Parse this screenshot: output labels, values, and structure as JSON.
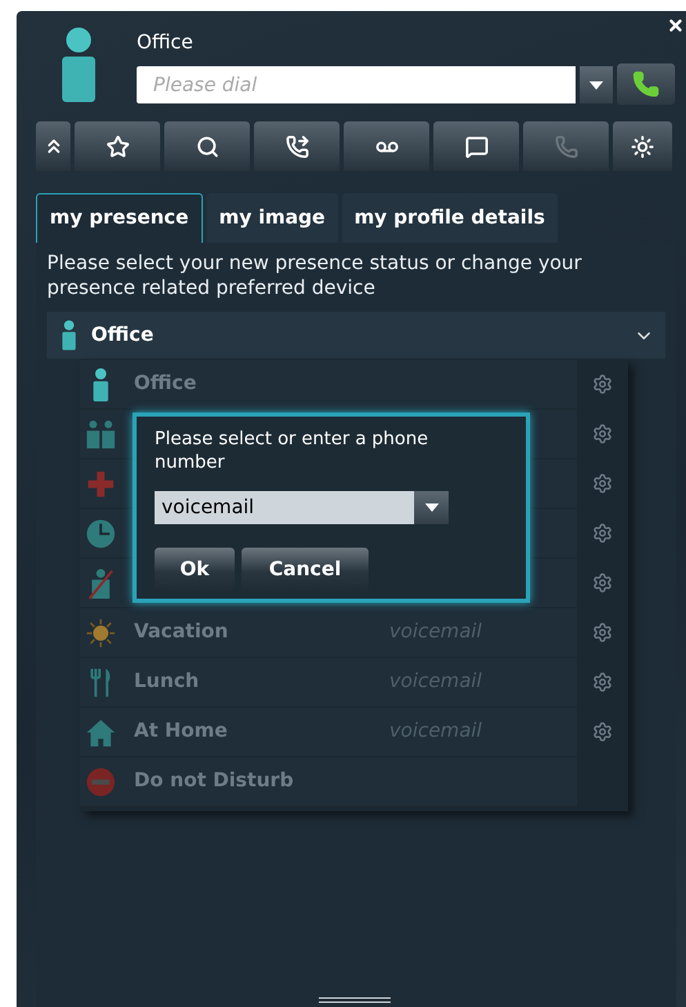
{
  "header": {
    "presence_label": "Office",
    "dial_field": {
      "placeholder": "Please dial"
    }
  },
  "toolbar": [
    {
      "kind": "collapse",
      "disabled": false
    },
    {
      "kind": "favorites",
      "disabled": false
    },
    {
      "kind": "search",
      "disabled": false
    },
    {
      "kind": "forward",
      "disabled": false
    },
    {
      "kind": "voicemail",
      "disabled": false
    },
    {
      "kind": "chat",
      "disabled": false
    },
    {
      "kind": "phone",
      "disabled": true
    },
    {
      "kind": "settings",
      "disabled": false
    }
  ],
  "tabs": [
    {
      "label": "my presence",
      "selected": true
    },
    {
      "label": "my image",
      "selected": false
    },
    {
      "label": "my profile details",
      "selected": false
    }
  ],
  "description": "Please select your new presence status or change your presence related preferred device",
  "presence_select": {
    "value": "Office",
    "expanded": true
  },
  "presence_options": [
    {
      "kind": "office",
      "label": "Office",
      "has_settings": true
    },
    {
      "kind": "meeting",
      "has_settings": true
    },
    {
      "kind": "sick",
      "has_settings": true
    },
    {
      "kind": "clock",
      "has_settings": true
    },
    {
      "kind": "absent",
      "has_settings": true
    },
    {
      "kind": "vacation",
      "label": "Vacation",
      "device": "voicemail",
      "has_settings": true
    },
    {
      "kind": "lunch",
      "label": "Lunch",
      "device": "voicemail",
      "has_settings": true
    },
    {
      "kind": "home",
      "label": "At Home",
      "device": "voicemail",
      "has_settings": true
    },
    {
      "kind": "dnd",
      "label": "Do not Disturb",
      "has_settings": false
    }
  ],
  "dialog": {
    "message": "Please select or enter a phone number",
    "value": "voicemail",
    "buttons": [
      "Ok",
      "Cancel"
    ]
  }
}
